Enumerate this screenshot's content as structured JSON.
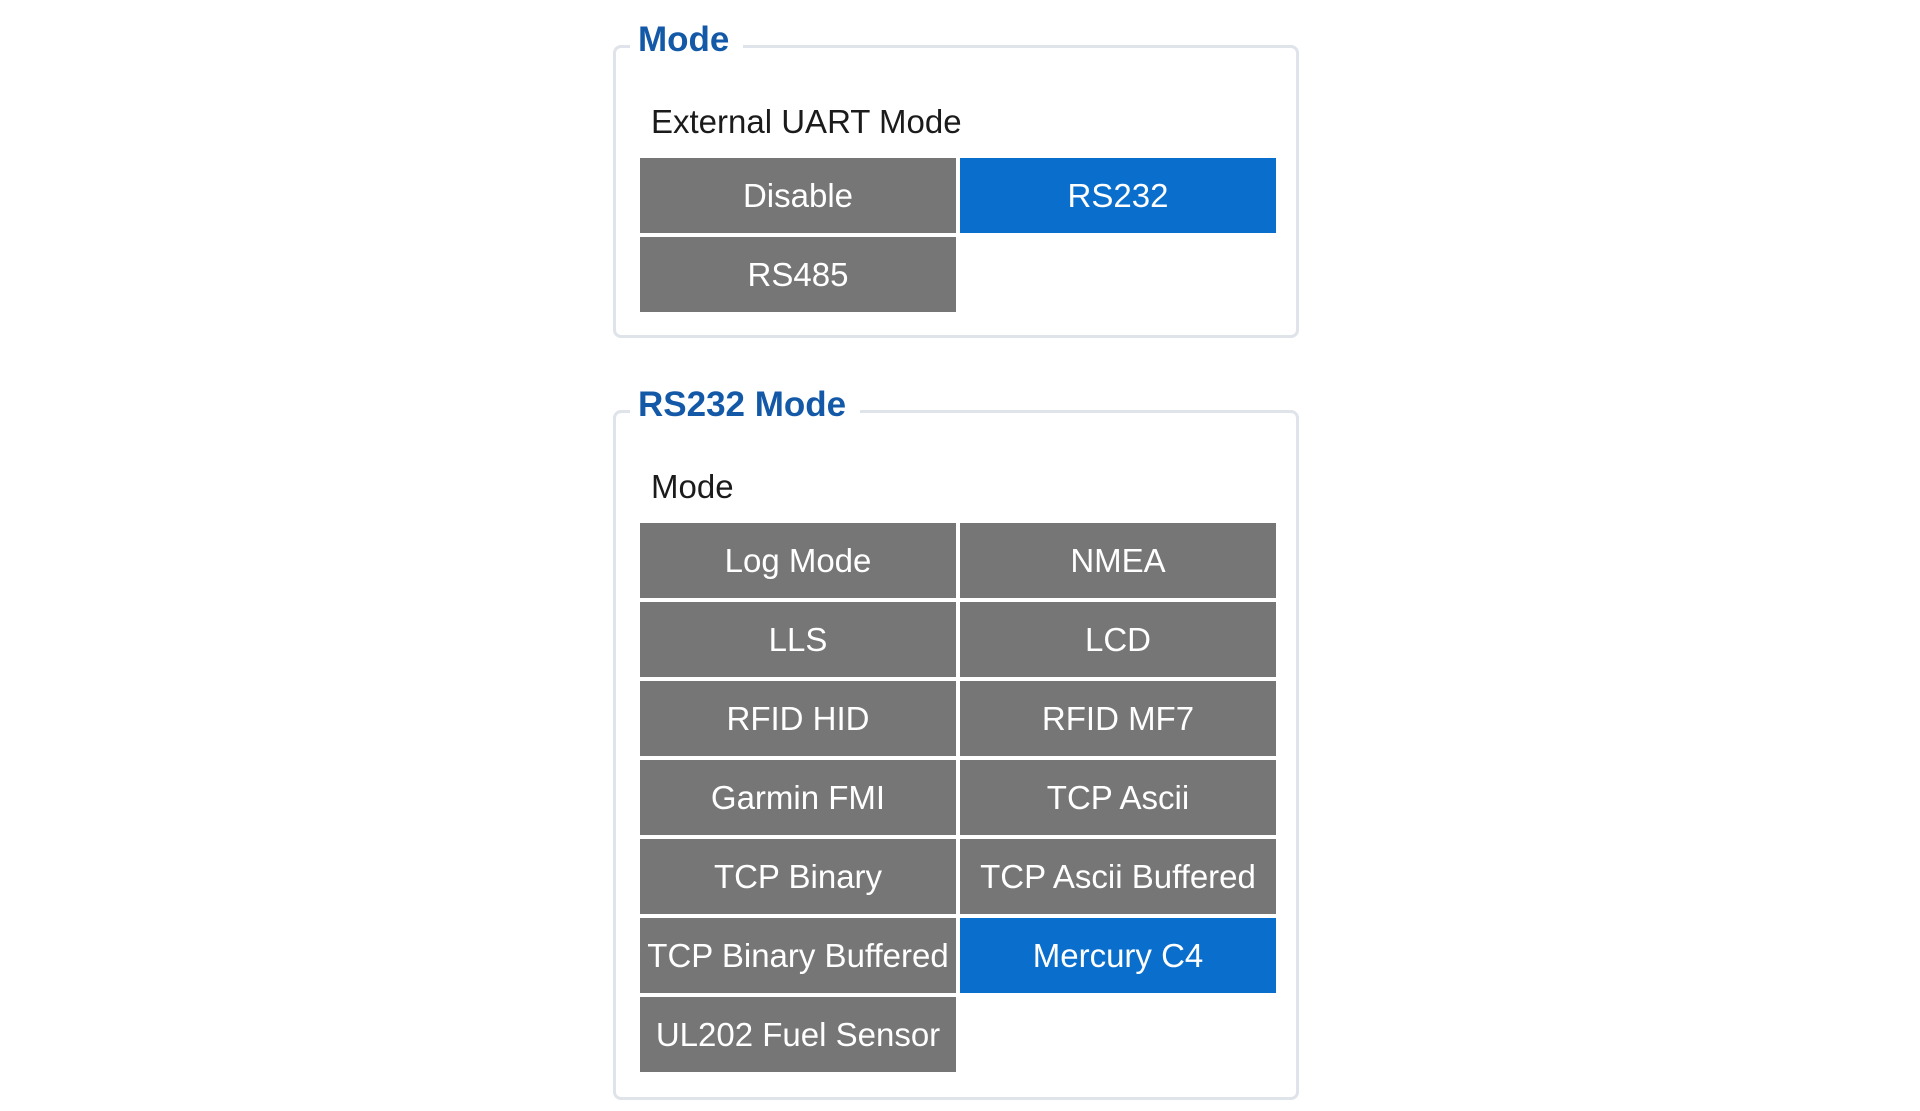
{
  "mode_group": {
    "title": "Mode",
    "field_label": "External UART Mode",
    "options": [
      {
        "label": "Disable",
        "selected": false
      },
      {
        "label": "RS232",
        "selected": true
      },
      {
        "label": "RS485",
        "selected": false
      }
    ]
  },
  "rs232_group": {
    "title": "RS232 Mode",
    "field_label": "Mode",
    "options": [
      {
        "label": "Log Mode",
        "selected": false
      },
      {
        "label": "NMEA",
        "selected": false
      },
      {
        "label": "LLS",
        "selected": false
      },
      {
        "label": "LCD",
        "selected": false
      },
      {
        "label": "RFID HID",
        "selected": false
      },
      {
        "label": "RFID MF7",
        "selected": false
      },
      {
        "label": "Garmin FMI",
        "selected": false
      },
      {
        "label": "TCP Ascii",
        "selected": false
      },
      {
        "label": "TCP Binary",
        "selected": false
      },
      {
        "label": "TCP Ascii Buffered",
        "selected": false
      },
      {
        "label": "TCP Binary Buffered",
        "selected": false
      },
      {
        "label": "Mercury C4",
        "selected": true
      },
      {
        "label": "UL202 Fuel Sensor",
        "selected": false
      }
    ]
  },
  "colors": {
    "option_default": "#767676",
    "option_selected": "#0a6fcc",
    "group_title": "#1459a8",
    "group_border": "#dfe3ea"
  }
}
